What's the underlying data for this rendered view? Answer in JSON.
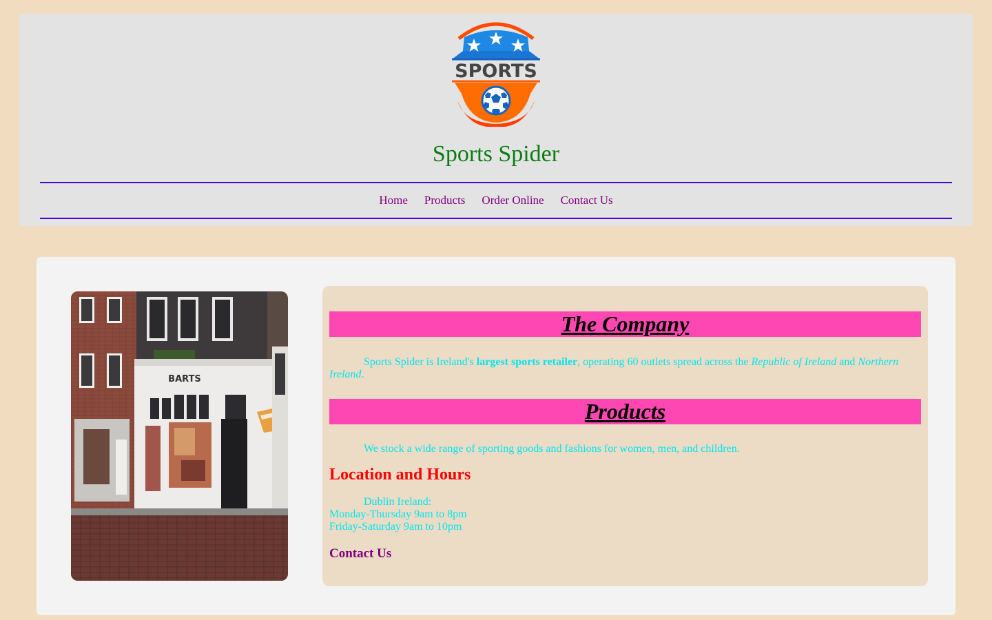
{
  "header": {
    "logo": {
      "text": "SPORTS",
      "icon": "soccer-ball-shield-logo",
      "colors": {
        "blue": "#1565c0",
        "orange": "#ff5a00",
        "red": "#ff2a00"
      }
    },
    "site_title": "Sports Spider"
  },
  "nav": {
    "items": [
      {
        "label": "Home"
      },
      {
        "label": "Products"
      },
      {
        "label": "Order Online"
      },
      {
        "label": "Contact Us"
      }
    ]
  },
  "main": {
    "store_photo": {
      "sign_text": "BARTS"
    },
    "company": {
      "heading": "The Company",
      "text_1": "Sports Spider is Ireland's ",
      "text_bold": "largest sports retailer",
      "text_2": ", operating 60 outlets spread across the ",
      "text_italic_1": "Republic of Ireland",
      "text_3": " and ",
      "text_italic_2": "Northern Ireland",
      "text_4": "."
    },
    "products": {
      "heading": "Products",
      "text": "We stock a wide range of sporting goods and fashions for women, men, and children."
    },
    "location": {
      "heading": "Location and Hours",
      "line_1": "Dublin Ireland:",
      "line_2": "Monday-Thursday 9am to 8pm",
      "line_3": "Friday-Saturday 9am to 10pm"
    },
    "contact": {
      "heading": "Contact Us"
    }
  },
  "colors": {
    "page_bg": "#f2dcbf",
    "header_bg": "#e3e3e3",
    "title_green": "#0a7d12",
    "nav_border": "#4a00d6",
    "nav_link": "#800080",
    "heading_bar": "#ff47b3",
    "body_text": "#00e5ee",
    "location_heading": "#ff0000"
  }
}
